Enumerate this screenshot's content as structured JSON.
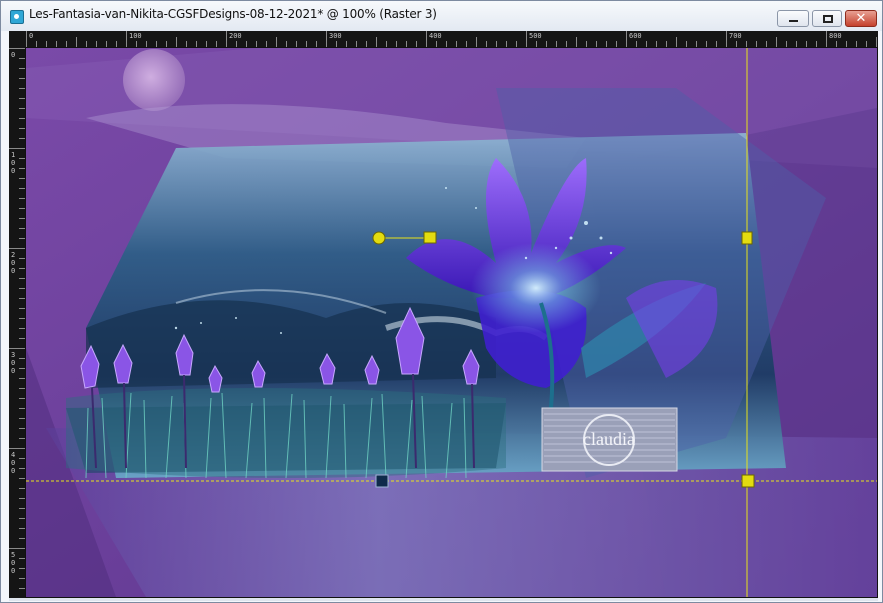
{
  "window": {
    "title": "Les-Fantasia-van-Nikita-CGSFDesigns-08-12-2021* @ 100% (Raster 3)",
    "buttons": {
      "minimize": "minimize",
      "maximize": "maximize",
      "close": "✕"
    }
  },
  "ruler_top": {
    "labels": [
      "0",
      "100",
      "200",
      "300",
      "400",
      "500",
      "600",
      "700",
      "800"
    ]
  },
  "ruler_left": {
    "labels": [
      "0",
      "100",
      "200",
      "300",
      "400",
      "500"
    ]
  },
  "watermark": {
    "text": "claudia"
  },
  "colors": {
    "bg_purple": "#6a3f9a",
    "accent_yellow": "#e8e21a",
    "sky_teal": "#3a8fb0",
    "flower_violet": "#7b3cf0"
  }
}
